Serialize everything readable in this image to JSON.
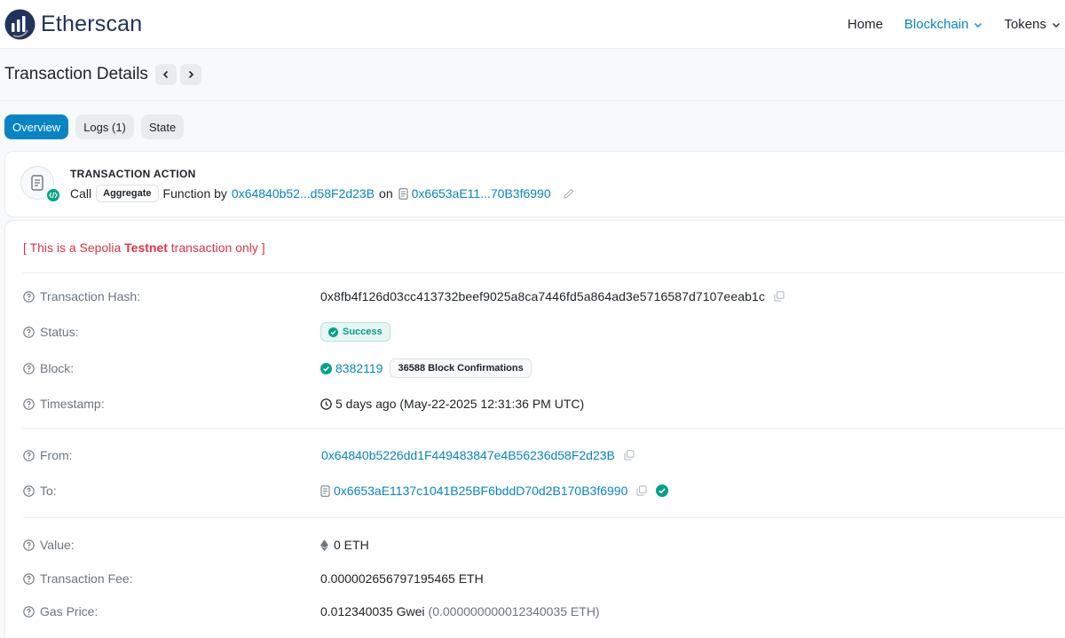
{
  "header": {
    "brand": "Etherscan",
    "nav": [
      {
        "label": "Home"
      },
      {
        "label": "Blockchain"
      },
      {
        "label": "Tokens"
      }
    ]
  },
  "page": {
    "title": "Transaction Details"
  },
  "tabs": [
    {
      "label": "Overview",
      "active": true
    },
    {
      "label": "Logs (1)",
      "active": false
    },
    {
      "label": "State",
      "active": false
    }
  ],
  "action": {
    "heading": "TRANSACTION ACTION",
    "call": "Call",
    "method": "Aggregate",
    "function_by": "Function by",
    "from_short": "0x64840b52...d58F2d23B",
    "on": "on",
    "to_short": "0x6653aE11...70B3f6990"
  },
  "notice": {
    "prefix": "[ This is a Sepolia ",
    "strong": "Testnet",
    "suffix": " transaction only ]"
  },
  "details": {
    "hash_label": "Transaction Hash:",
    "hash": "0x8fb4f126d03cc413732beef9025a8ca7446fd5a864ad3e5716587d7107eeab1c",
    "status_label": "Status:",
    "status": "Success",
    "block_label": "Block:",
    "block": "8382119",
    "confirmations": "36588 Block Confirmations",
    "timestamp_label": "Timestamp:",
    "timestamp": "5 days ago (May-22-2025 12:31:36 PM UTC)",
    "from_label": "From:",
    "from": "0x64840b5226dd1F449483847e4B56236d58F2d23B",
    "to_label": "To:",
    "to": "0x6653aE1137c1041B25BF6bddD70d2B170B3f6990",
    "value_label": "Value:",
    "value": "0 ETH",
    "fee_label": "Transaction Fee:",
    "fee": "0.000002656797195465 ETH",
    "gas_label": "Gas Price:",
    "gas_gwei": "0.012340035 Gwei",
    "gas_eth": "(0.000000000012340035 ETH)"
  },
  "colors": {
    "accent": "#0784c3",
    "success": "#00a186",
    "danger": "#dc3545"
  }
}
